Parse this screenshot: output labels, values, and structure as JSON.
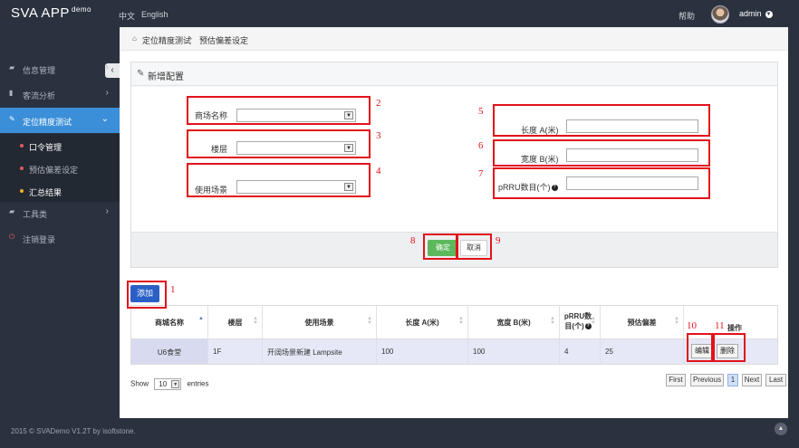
{
  "header": {
    "logo": "SVA APP",
    "logo_sup": "demo",
    "lang_zh": "中文",
    "lang_en": "English",
    "help": "帮助",
    "user": "admin"
  },
  "sidebar": {
    "items": [
      {
        "label": "信息管理",
        "icon": "folder-icon"
      },
      {
        "label": "客流分析",
        "icon": "bar-chart-icon"
      },
      {
        "label": "定位精度测试",
        "icon": "edit-icon"
      },
      {
        "label": "工具类",
        "icon": "folder-icon"
      },
      {
        "label": "注销登录",
        "icon": "power-icon"
      }
    ],
    "subitems": [
      {
        "label": "口令管理",
        "dot_color": "#e05b5b"
      },
      {
        "label": "预估偏差设定",
        "dot_color": "#e05b5b"
      },
      {
        "label": "汇总结果",
        "dot_color": "#f0ad2a"
      }
    ],
    "active_color": "#3b8fd8"
  },
  "breadcrumb": {
    "home": "定位精度测试",
    "current": "预估偏差设定"
  },
  "form": {
    "title": "新增配置",
    "mall_label": "商场名称",
    "floor_label": "楼层",
    "scene_label": "使用场景",
    "length_label": "长度 A(米)",
    "width_label": "宽度 B(米)",
    "prru_label": "pRRU数目(个)",
    "confirm": "确定",
    "cancel": "取消"
  },
  "annotations": [
    "1",
    "2",
    "3",
    "4",
    "5",
    "6",
    "7",
    "8",
    "9",
    "10",
    "11"
  ],
  "actions": {
    "add": "添加"
  },
  "table": {
    "columns": [
      "商城名称",
      "楼层",
      "使用场景",
      "长度 A(米)",
      "宽度 B(米)",
      "pRRU数目(个)",
      "预估偏差",
      "操作"
    ],
    "rows": [
      {
        "mall": "U6食堂",
        "floor": "1F",
        "scene": "开阔场景新建 Lampsite",
        "length": "100",
        "width": "100",
        "prru": "4",
        "deviation": "25",
        "edit": "编辑",
        "delete": "删除"
      }
    ]
  },
  "pagination": {
    "show": "Show",
    "page_size": "10",
    "entries": "entries",
    "first": "First",
    "previous": "Previous",
    "current": "1",
    "next": "Next",
    "last": "Last"
  },
  "footer": {
    "text": "2015 © SVADemo V1.2T by isoftstone."
  }
}
